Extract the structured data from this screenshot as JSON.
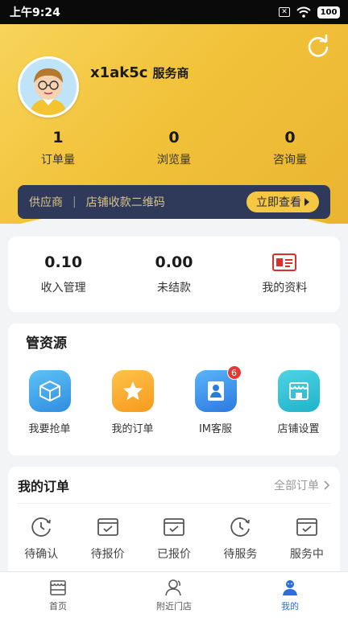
{
  "status_bar": {
    "time": "上午9:24",
    "battery": "100"
  },
  "profile": {
    "username": "x1ak5c",
    "role": "服务商"
  },
  "stats": [
    {
      "value": "1",
      "label": "订单量"
    },
    {
      "value": "0",
      "label": "浏览量"
    },
    {
      "value": "0",
      "label": "咨询量"
    }
  ],
  "banner": {
    "supplier": "供应商",
    "separator": "|",
    "qr_text": "店铺收款二维码",
    "button": "立即查看"
  },
  "finance": {
    "income": {
      "value": "0.10",
      "label": "收入管理"
    },
    "unsettled": {
      "value": "0.00",
      "label": "未结款"
    },
    "profile_info": {
      "label": "我的资料"
    }
  },
  "resources": {
    "title": "管资源",
    "items": [
      {
        "label": "我要抢单",
        "icon": "box-icon"
      },
      {
        "label": "我的订单",
        "icon": "star-icon"
      },
      {
        "label": "IM客服",
        "icon": "person-icon",
        "badge": "6"
      },
      {
        "label": "店铺设置",
        "icon": "store-icon"
      }
    ]
  },
  "orders": {
    "title": "我的订单",
    "all": "全部订单",
    "items": [
      {
        "label": "待确认",
        "icon": "clock-icon"
      },
      {
        "label": "待报价",
        "icon": "box-check-icon"
      },
      {
        "label": "已报价",
        "icon": "box-check-icon"
      },
      {
        "label": "待服务",
        "icon": "clock-icon"
      },
      {
        "label": "服务中",
        "icon": "box-check-icon"
      }
    ]
  },
  "tabs": [
    {
      "label": "首页",
      "icon": "store-icon"
    },
    {
      "label": "附近门店",
      "icon": "user-icon"
    },
    {
      "label": "我的",
      "icon": "profile-icon",
      "active": true
    }
  ],
  "colors": {
    "accent_yellow": "#f2c23a",
    "banner_dark": "#2f3a5a",
    "tab_active": "#2a6fdb"
  }
}
